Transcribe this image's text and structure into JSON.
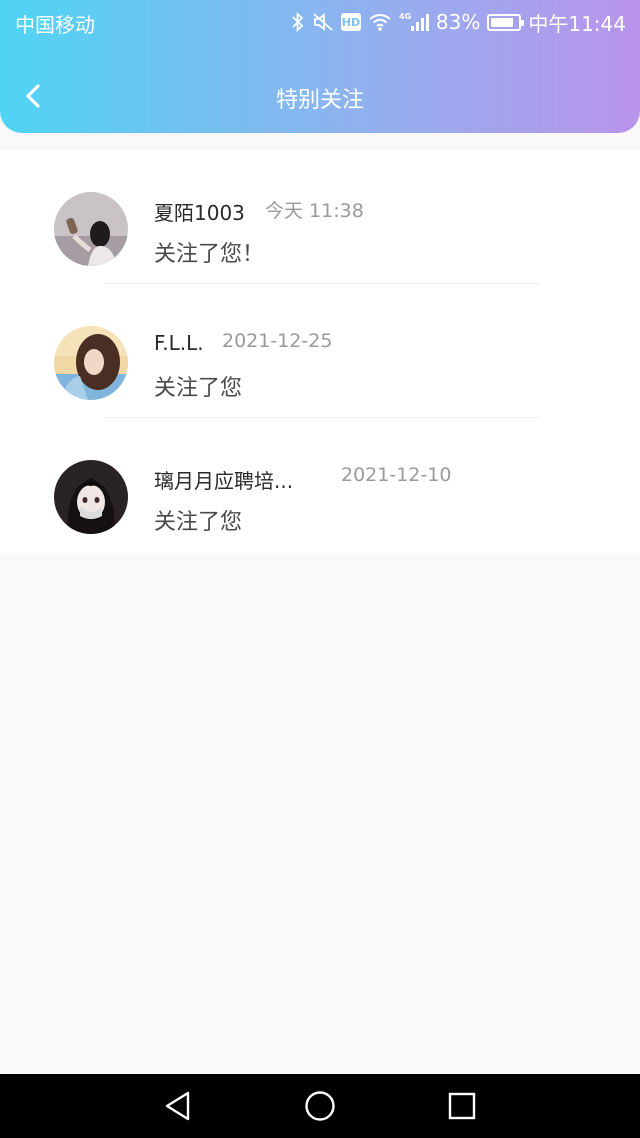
{
  "status_bar": {
    "carrier": "中国移动",
    "battery_percent": "83%",
    "battery_level": 0.83,
    "time": "中午11:44",
    "icons": [
      "bluetooth-icon",
      "mute-icon",
      "hd-icon",
      "wifi-icon",
      "signal-4g-icon",
      "battery-icon"
    ],
    "hd_label": "HD"
  },
  "header": {
    "title": "特别关注",
    "gradient": [
      "#4fd4f4",
      "#b994ea"
    ]
  },
  "follows": [
    {
      "name": "夏陌1003",
      "time": "今天 11:38",
      "message": "关注了您！"
    },
    {
      "name": "F.L.L.",
      "time": "2021-12-25",
      "message": "关注了您"
    },
    {
      "name": "璃月月应聘培...",
      "time": "2021-12-10",
      "message": "关注了您"
    }
  ],
  "nav": {
    "icons": [
      "back-triangle-icon",
      "home-circle-icon",
      "recents-square-icon"
    ]
  }
}
